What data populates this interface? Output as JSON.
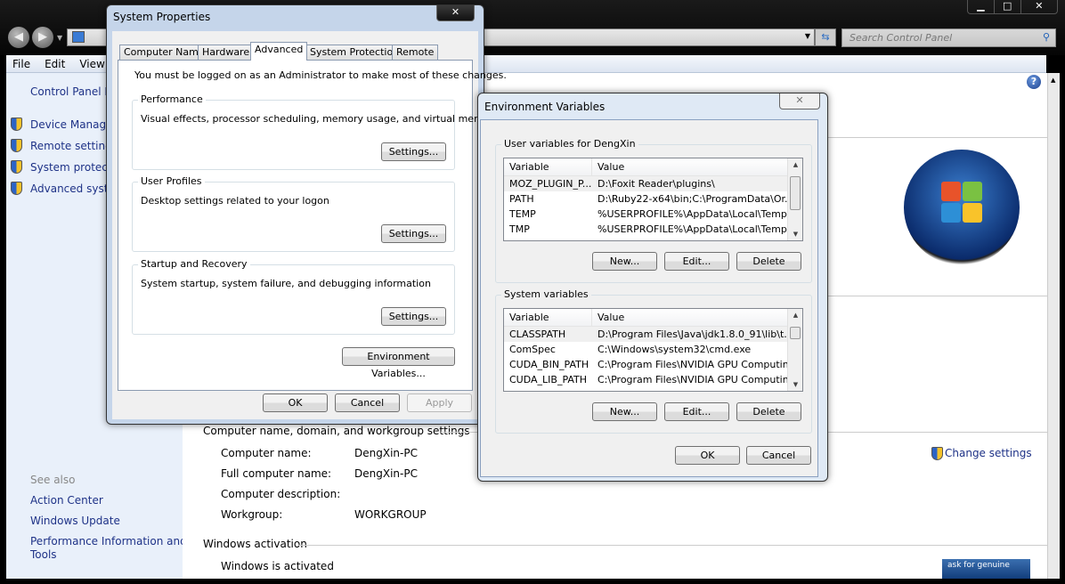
{
  "explorer": {
    "search_placeholder": "Search Control Panel",
    "menu": [
      "File",
      "Edit",
      "View"
    ],
    "left": {
      "home": "Control Panel H",
      "items": [
        "Device Manager",
        "Remote settings",
        "System protection",
        "Advanced system settings"
      ],
      "see_also": "See also",
      "links": [
        "Action Center",
        "Windows Update",
        "Performance Information and",
        "Tools"
      ]
    },
    "main": {
      "section1": "Computer name, domain, and workgroup settings",
      "rows": [
        {
          "label": "Computer name:",
          "value": "DengXin-PC"
        },
        {
          "label": "Full computer name:",
          "value": "DengXin-PC"
        },
        {
          "label": "Computer description:",
          "value": ""
        },
        {
          "label": "Workgroup:",
          "value": "WORKGROUP"
        }
      ],
      "change_settings": "Change settings",
      "section2": "Windows activation",
      "activation": "Windows is activated",
      "genuine": "ask for genuine"
    }
  },
  "sysprops": {
    "title": "System Properties",
    "tabs": [
      "Computer Name",
      "Hardware",
      "Advanced",
      "System Protection",
      "Remote"
    ],
    "active_tab": "Advanced",
    "notice": "You must be logged on as an Administrator to make most of these changes.",
    "groups": [
      {
        "title": "Performance",
        "desc": "Visual effects, processor scheduling, memory usage, and virtual memory",
        "button": "Settings..."
      },
      {
        "title": "User Profiles",
        "desc": "Desktop settings related to your logon",
        "button": "Settings..."
      },
      {
        "title": "Startup and Recovery",
        "desc": "System startup, system failure, and debugging information",
        "button": "Settings..."
      }
    ],
    "env_button": "Environment Variables...",
    "ok": "OK",
    "cancel": "Cancel",
    "apply": "Apply"
  },
  "envvars": {
    "title": "Environment Variables",
    "user_group": "User variables for DengXin",
    "col_variable": "Variable",
    "col_value": "Value",
    "user_vars": [
      {
        "name": "MOZ_PLUGIN_P...",
        "value": "D:\\Foxit Reader\\plugins\\"
      },
      {
        "name": "PATH",
        "value": "D:\\Ruby22-x64\\bin;C:\\ProgramData\\Or..."
      },
      {
        "name": "TEMP",
        "value": "%USERPROFILE%\\AppData\\Local\\Temp"
      },
      {
        "name": "TMP",
        "value": "%USERPROFILE%\\AppData\\Local\\Temp"
      }
    ],
    "system_group": "System variables",
    "system_vars": [
      {
        "name": "CLASSPATH",
        "value": "D:\\Program Files\\Java\\jdk1.8.0_91\\lib\\t..."
      },
      {
        "name": "ComSpec",
        "value": "C:\\Windows\\system32\\cmd.exe"
      },
      {
        "name": "CUDA_BIN_PATH",
        "value": "C:\\Program Files\\NVIDIA GPU Computin..."
      },
      {
        "name": "CUDA_LIB_PATH",
        "value": "C:\\Program Files\\NVIDIA GPU Computin..."
      }
    ],
    "new": "New...",
    "edit": "Edit...",
    "delete": "Delete",
    "ok": "OK",
    "cancel": "Cancel"
  }
}
